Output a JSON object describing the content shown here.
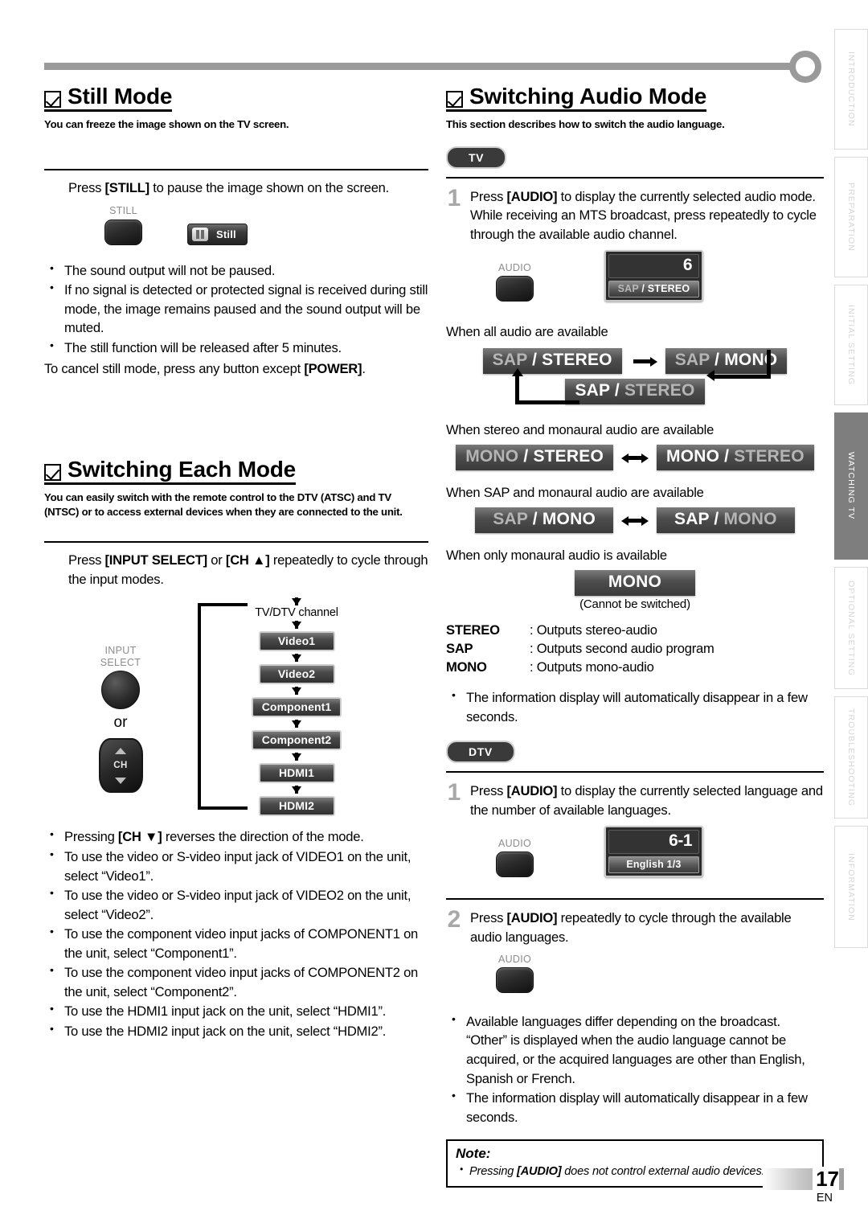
{
  "side_tabs": [
    {
      "label": "INTRODUCTION",
      "active": false
    },
    {
      "label": "PREPARATION",
      "active": false
    },
    {
      "label": "INITIAL  SETTING",
      "active": false
    },
    {
      "label": "WATCHING TV",
      "active": true
    },
    {
      "label": "OPTIONAL  SETTING",
      "active": false
    },
    {
      "label": "TROUBLESHOOTING",
      "active": false
    },
    {
      "label": "INFORMATION",
      "active": false
    }
  ],
  "still_mode": {
    "title": "Still Mode",
    "subtitle": "You can freeze the image shown on the TV screen.",
    "instruction_pre": "Press ",
    "instruction_key": "[STILL]",
    "instruction_post": " to pause the image shown on the screen.",
    "button_label": "STILL",
    "osd_label": "Still",
    "bullets": [
      "The sound output will not be paused.",
      "If no signal is detected or protected signal is received during still mode, the image remains paused and the sound output will be muted.",
      "The still function will be released after 5 minutes."
    ],
    "cancel_pre": "To cancel still mode, press any button except ",
    "cancel_key": "[POWER]",
    "cancel_post": "."
  },
  "switching_each_mode": {
    "title": "Switching Each Mode",
    "subtitle": "You can easily switch with the remote control to the DTV (ATSC) and TV (NTSC) or to access external devices when they are connected to the unit.",
    "instruction_pre": "Press ",
    "instruction_key1": "[INPUT SELECT]",
    "instruction_mid": " or ",
    "instruction_key2": "[CH ▲]",
    "instruction_post": " repeatedly to cycle through the input modes.",
    "input_select_label": "INPUT\nSELECT",
    "or_label": "or",
    "ch_label": "CH",
    "flow_top_label": "TV/DTV channel",
    "flow_items": [
      "Video1",
      "Video2",
      "Component1",
      "Component2",
      "HDMI1",
      "HDMI2"
    ],
    "bullets": [
      "Pressing [CH ▼] reverses the direction of the mode.",
      "To use the video or S-video input jack of VIDEO1 on the unit, select “Video1”.",
      "To use the video or S-video input jack of VIDEO2 on the unit, select “Video2”.",
      "To use the component video input jacks of COMPONENT1 on the unit, select “Component1”.",
      "To use the component video input jacks of COMPONENT2 on the unit, select “Component2”.",
      "To use the HDMI1 input jack on the unit, select “HDMI1”.",
      "To use the HDMI2 input jack on the unit, select “HDMI2”."
    ]
  },
  "switching_audio_mode": {
    "title": "Switching Audio Mode",
    "subtitle": "This section describes how to switch the audio language.",
    "tv_badge": "TV",
    "dtv_badge": "DTV",
    "tv_step1_num": "1",
    "tv_step1_pre": "Press ",
    "tv_step1_key": "[AUDIO]",
    "tv_step1_post": " to display the currently selected audio mode. While receiving an MTS broadcast, press repeatedly to cycle through the available audio channel.",
    "audio_button_label": "AUDIO",
    "osd_tv": {
      "number": "6",
      "mode_dim": "SAP",
      "mode_lit": " / STEREO"
    },
    "cap_all": "When all audio are available",
    "cycle_all": {
      "a_dim": "SAP",
      "a_lit": " / STEREO",
      "b_dim": "SAP",
      "b_lit": " / MONO",
      "c_lit": "SAP / ",
      "c_dim": "STEREO"
    },
    "cap_stereo_mono": "When stereo and monaural audio are available",
    "pair_stereo_mono": {
      "left_dim": "MONO",
      "left_lit": " / STEREO",
      "right_lit": "MONO / ",
      "right_dim": "STEREO"
    },
    "cap_sap_mono": "When SAP and monaural audio are available",
    "pair_sap_mono": {
      "left_dim": "SAP",
      "left_lit": " / MONO",
      "right_lit": "SAP / ",
      "right_dim": "MONO"
    },
    "cap_mono_only": "When only monaural audio is available",
    "mono_chip": "MONO",
    "cannot_switch": "(Cannot be switched)",
    "glossary": [
      {
        "key": "STEREO",
        "value": ": Outputs stereo-audio"
      },
      {
        "key": "SAP",
        "value": ": Outputs second audio program"
      },
      {
        "key": "MONO",
        "value": ": Outputs mono-audio"
      }
    ],
    "tv_note_bullet": "The information display will automatically disappear in a few seconds.",
    "dtv_step1_num": "1",
    "dtv_step1_pre": "Press ",
    "dtv_step1_key": "[AUDIO]",
    "dtv_step1_post": " to display the currently selected language and the number of available languages.",
    "osd_dtv": {
      "number": "6-1",
      "sub": "English 1/3"
    },
    "dtv_step2_num": "2",
    "dtv_step2_pre": "Press ",
    "dtv_step2_key": "[AUDIO]",
    "dtv_step2_post": " repeatedly to cycle through the available audio languages.",
    "dtv_bullets": [
      "Available languages differ depending on the broadcast. “Other” is displayed when the audio language cannot be acquired, or the acquired languages are other than English, Spanish or French.",
      "The information display will automatically disappear in a few seconds."
    ],
    "note_title": "Note:",
    "note_bullets_pre": "Pressing ",
    "note_bullets_key": "[AUDIO]",
    "note_bullets_post": " does not control external audio devices."
  },
  "footer": {
    "page_number": "17",
    "language": "EN"
  }
}
